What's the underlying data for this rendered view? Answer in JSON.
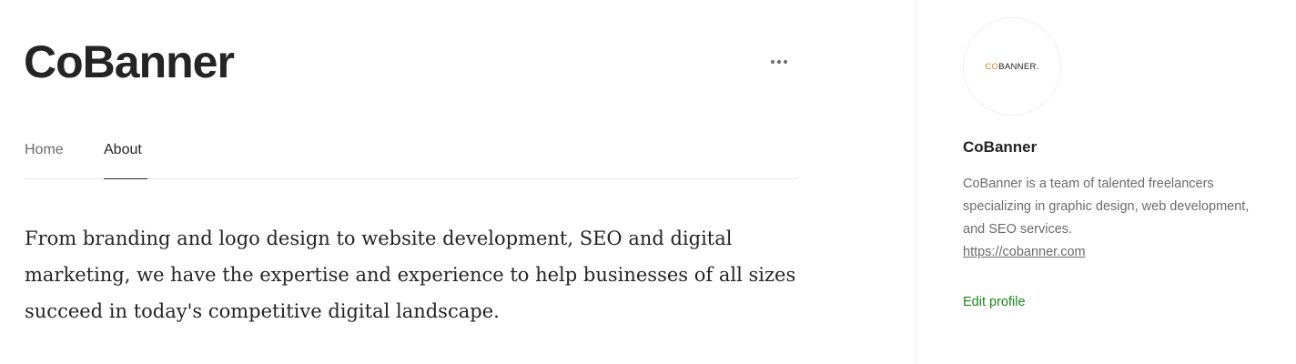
{
  "main": {
    "title": "CoBanner",
    "more_icon": "more-horizontal-icon",
    "tabs": [
      {
        "label": "Home",
        "active": false
      },
      {
        "label": "About",
        "active": true
      }
    ],
    "about_text": "From branding and logo design to website development, SEO and digital marketing, we have the expertise and experience to help businesses of all sizes succeed in today's competitive digital landscape."
  },
  "sidebar": {
    "avatar_logo": {
      "part_accent": "CO",
      "part_main": "BANNER",
      "dot": "."
    },
    "name": "CoBanner",
    "bio": "CoBanner is a team of talented freelancers specializing in graphic design, web development, and SEO services.",
    "link": "https://cobanner.com",
    "edit_profile_label": "Edit profile"
  },
  "colors": {
    "text_primary": "#242424",
    "text_secondary": "#6b6b6b",
    "accent_green": "#1a8917",
    "logo_orange": "#d9822b",
    "divider": "#e6e6e6"
  }
}
